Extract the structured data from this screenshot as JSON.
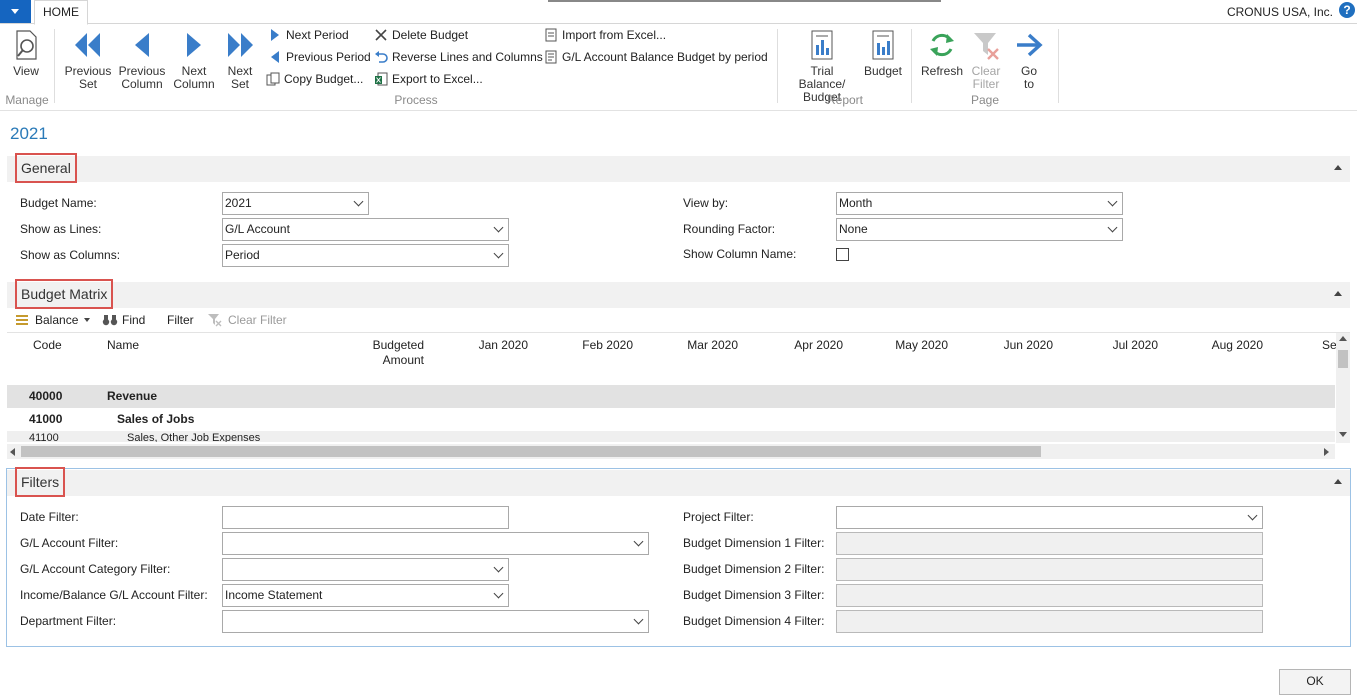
{
  "topbar": {
    "tab_home": "HOME",
    "company": "CRONUS USA, Inc.",
    "help": "?"
  },
  "ribbon": {
    "view": "View",
    "previous_set": [
      "Previous",
      "Set"
    ],
    "previous_column": [
      "Previous",
      "Column"
    ],
    "next_column": [
      "Next",
      "Column"
    ],
    "next_set": [
      "Next",
      "Set"
    ],
    "next_period": "Next Period",
    "previous_period": "Previous Period",
    "copy_budget": "Copy Budget...",
    "delete_budget": "Delete Budget",
    "reverse_lines": "Reverse Lines and Columns",
    "export_excel": "Export to Excel...",
    "import_excel": "Import from Excel...",
    "gl_balance_budget": "G/L Account Balance Budget by period",
    "trial_balance": [
      "Trial Balance/",
      "Budget"
    ],
    "budget": "Budget",
    "refresh": "Refresh",
    "clear_filter": [
      "Clear",
      "Filter"
    ],
    "go_to": [
      "Go",
      "to"
    ],
    "groups": {
      "manage": "Manage",
      "process": "Process",
      "report": "Report",
      "page": "Page"
    }
  },
  "page_title": "2021",
  "general": {
    "title": "General",
    "budget_name_label": "Budget Name:",
    "budget_name": "2021",
    "show_lines_label": "Show as Lines:",
    "show_lines": "G/L Account",
    "show_columns_label": "Show as Columns:",
    "show_columns": "Period",
    "view_by_label": "View by:",
    "view_by": "Month",
    "rounding_label": "Rounding Factor:",
    "rounding": "None",
    "show_col_name_label": "Show Column Name:"
  },
  "matrix": {
    "title": "Budget Matrix",
    "toolbar": {
      "balance": "Balance",
      "find": "Find",
      "filter": "Filter",
      "clear_filter": "Clear Filter"
    },
    "headers": {
      "code": "Code",
      "name": "Name",
      "budgeted": [
        "Budgeted",
        "Amount"
      ],
      "months": [
        "Jan 2020",
        "Feb 2020",
        "Mar 2020",
        "Apr 2020",
        "May 2020",
        "Jun 2020",
        "Jul 2020",
        "Aug 2020",
        "Se"
      ]
    },
    "rows": [
      {
        "code": "40000",
        "name": "Revenue"
      },
      {
        "code": "41000",
        "name": "Sales of Jobs"
      },
      {
        "code": "41100",
        "name": "Sales, Other Job Expenses"
      }
    ]
  },
  "filters": {
    "title": "Filters",
    "date_label": "Date Filter:",
    "date": "",
    "gl_account_label": "G/L Account Filter:",
    "gl_account": "",
    "gl_category_label": "G/L Account Category Filter:",
    "gl_category": "",
    "income_balance_label": "Income/Balance G/L Account Filter:",
    "income_balance": "Income Statement",
    "department_label": "Department Filter:",
    "department": "",
    "project_label": "Project Filter:",
    "project": "",
    "dim1_label": "Budget Dimension 1 Filter:",
    "dim2_label": "Budget Dimension 2 Filter:",
    "dim3_label": "Budget Dimension 3 Filter:",
    "dim4_label": "Budget Dimension 4 Filter:"
  },
  "ok": "OK"
}
